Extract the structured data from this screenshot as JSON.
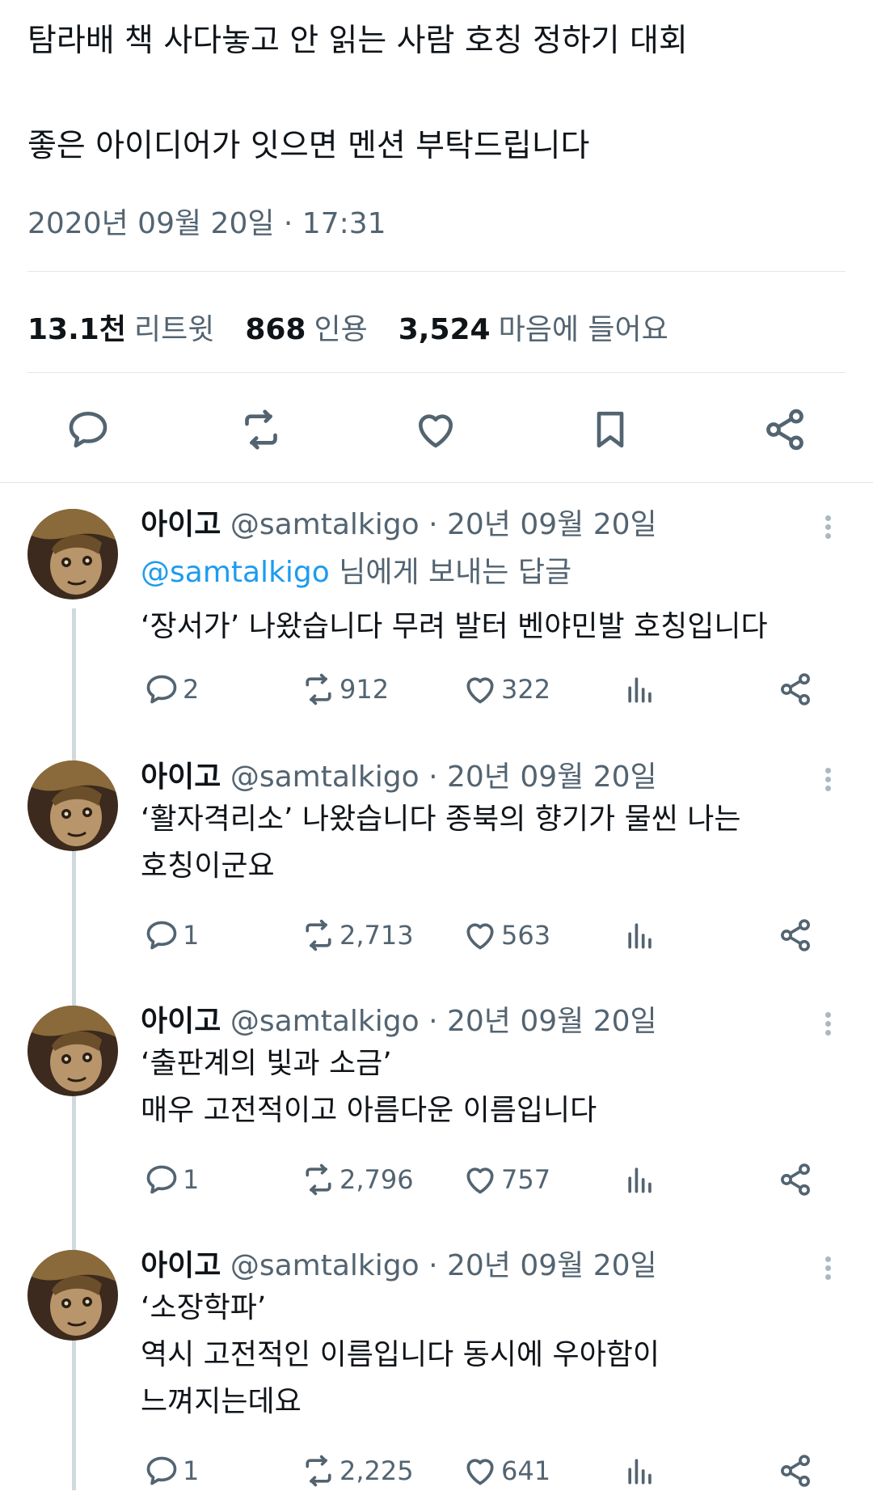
{
  "tweet": {
    "line1": "탐라배 책 사다놓고 안 읽는 사람 호칭 정하기 대회",
    "line2": "좋은 아이디어가 잇으면 멘션 부탁드립니다",
    "timestamp": "2020년 09월 20일 · 17:31"
  },
  "stats": {
    "retweets_count": "13.1천",
    "retweets_label": "리트윗",
    "quotes_count": "868",
    "quotes_label": "인용",
    "likes_count": "3,524",
    "likes_label": "마음에 들어요"
  },
  "icons": {
    "reply": "reply-icon",
    "retweet": "retweet-icon",
    "like": "heart-icon",
    "bookmark": "bookmark-icon",
    "share": "share-icon",
    "views": "analytics-icon",
    "more": "more-icon"
  },
  "colors": {
    "text": "#0f1419",
    "secondary": "#536471",
    "link": "#1d9bf0",
    "divider": "#e3e7ea"
  },
  "replies": [
    {
      "name": "아이고",
      "handle": "@samtalkigo",
      "dot": "·",
      "date": "20년 09월 20일",
      "reply_to_mention": "@samtalkigo",
      "reply_to_suffix": " 님에게 보내는 답글",
      "text_lines": [
        "‘장서가’ 나왔습니다 무려 발터 벤야민발 호칭입니다"
      ],
      "reply_count": "2",
      "retweet_count": "912",
      "like_count": "322"
    },
    {
      "name": "아이고",
      "handle": "@samtalkigo",
      "dot": "·",
      "date": "20년 09월 20일",
      "text_lines": [
        "‘활자격리소’ 나왔습니다 종북의 향기가 물씬 나는",
        "호칭이군요"
      ],
      "reply_count": "1",
      "retweet_count": "2,713",
      "like_count": "563"
    },
    {
      "name": "아이고",
      "handle": "@samtalkigo",
      "dot": "·",
      "date": "20년 09월 20일",
      "text_lines": [
        "‘출판계의 빛과 소금’",
        "매우 고전적이고 아름다운 이름입니다"
      ],
      "reply_count": "1",
      "retweet_count": "2,796",
      "like_count": "757"
    },
    {
      "name": "아이고",
      "handle": "@samtalkigo",
      "dot": "·",
      "date": "20년 09월 20일",
      "text_lines": [
        "‘소장학파’",
        "역시 고전적인 이름입니다 동시에 우아함이",
        "느껴지는데요"
      ],
      "reply_count": "1",
      "retweet_count": "2,225",
      "like_count": "641"
    }
  ]
}
